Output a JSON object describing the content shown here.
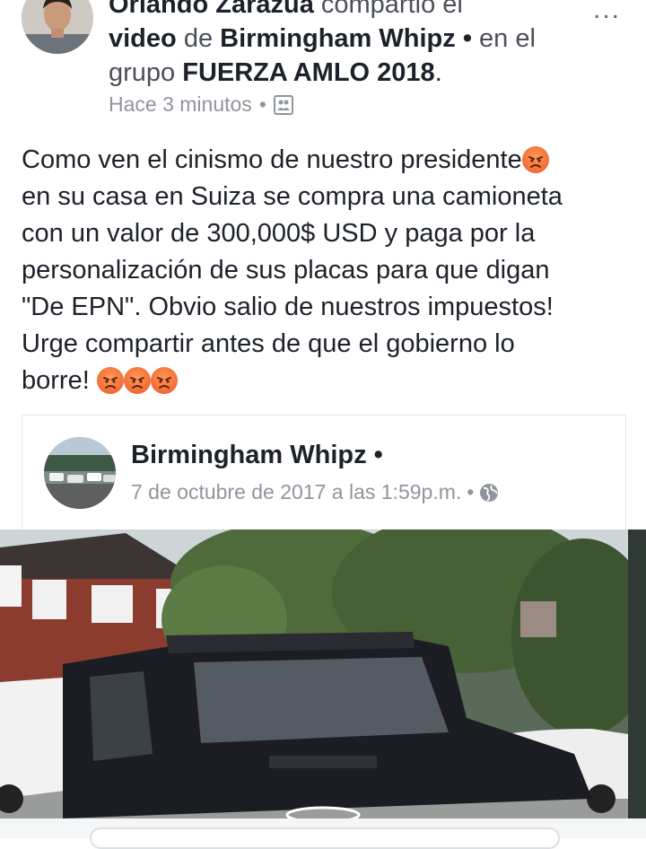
{
  "header": {
    "author": "Orlando Zarazúa",
    "action_prefix": "compartió el",
    "object": "video",
    "of_word": "de",
    "page": "Birmingham Whipz",
    "bullet": "•",
    "in_word": "en el",
    "group_word": "grupo",
    "group": "FUERZA AMLO 2018",
    "period": ".",
    "time": "Hace 3 minutos",
    "privacy_icon": "group-audience-icon",
    "more_label": "..."
  },
  "post": {
    "line1": "Como ven el cinismo de nuestro presidente",
    "line2": "en su casa en Suiza se compra una camioneta",
    "line3": "con un valor de 300,000$ USD y paga por la",
    "line4": "personalización de sus placas para que digan",
    "line5": "\"De EPN\". Obvio salio de nuestros impuestos!",
    "line6": "Urge compartir antes de que el gobierno lo",
    "line7": "borre!",
    "emoji": "angry-face-emoji"
  },
  "shared": {
    "name": "Birmingham Whipz",
    "bullet": "•",
    "date": "7 de octubre de 2017 a las 1:59p.m.",
    "date_bullet": "•",
    "privacy_icon": "globe-icon"
  },
  "colors": {
    "text": "#1d2129",
    "meta": "#90949c",
    "emoji": "#f46b35"
  }
}
